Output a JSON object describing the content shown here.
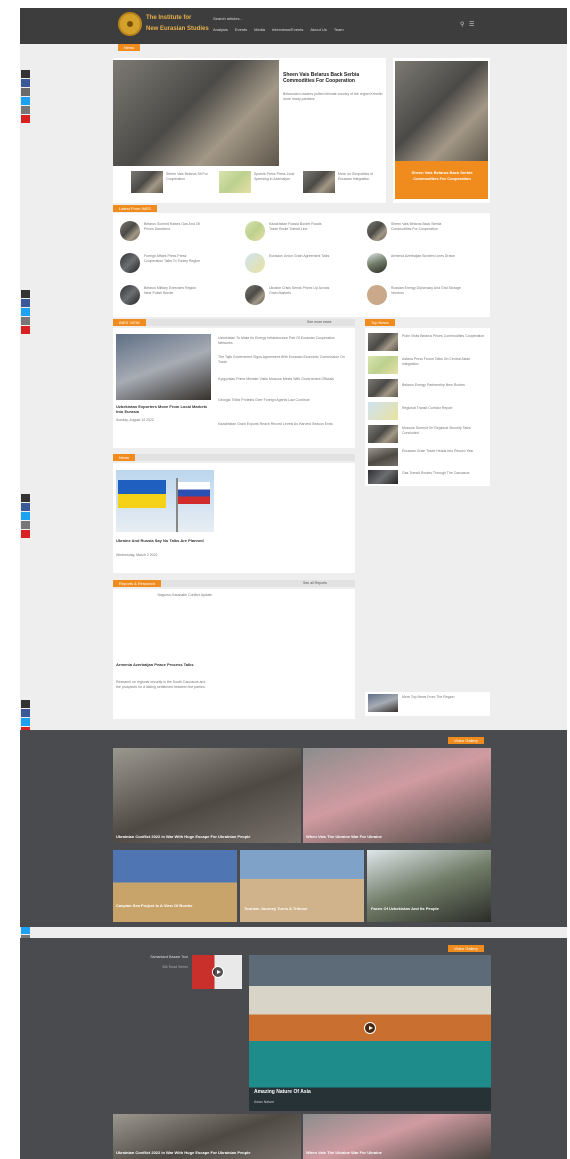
{
  "header": {
    "logo_line1": "The Institute for",
    "logo_line2": "New Eurasian Studies",
    "search_text": "Search articles...",
    "nav": [
      "Analysis",
      "Events",
      "Media",
      "Interviews/Events",
      "About Us",
      "Team"
    ]
  },
  "tabs": {
    "news": "News",
    "latest_news": "Latest From INES",
    "ines_view": "INES VIEW",
    "top_news": "Top News",
    "news2": "News",
    "ines_reports": "Reports & Research",
    "video_gallery": "Video Gallery",
    "video_gallery2": "Video Gallery"
  },
  "view_all": "See more news",
  "hero": {
    "title": "Sheen Vais Belarus Back Serbia Commodities For Cooperation",
    "excerpt": "Belarusian Leaders pulled intimate country of the region Kremlin more ready partners",
    "side_caption": "Sheen Vais Belarus Back Serbia Commodities For Cooperation"
  },
  "hero_strip": [
    "Sheen Vais Belarus Sit For Cooperation",
    "Sputnik Press Press Zone Spending in Azerbaijan",
    "More on Geopolitics of Eurasian Integration"
  ],
  "latest": [
    "Belarus Summit Raises Gas And Oil Prices Sanctions",
    "Kazakhstan Russia Border Roads Trade Route Transit Line",
    "Sheen Vais Belarus Back Serbia Commodities For Cooperation",
    "Foreign Affairs Press Press Cooperation Talks To Turkey Region",
    "Eurasian Union Grain Agreement Talks",
    "Armenia Azerbaijan Borders Lines Drawn",
    "Belarus Military Exercises Region Near Polish Border",
    "Ukraine Crisis Sends Prices Up Across Grain Markets",
    "Russian Energy Diplomacy And Grid Storage Vendors"
  ],
  "ines_view": {
    "lead_title": "Uzbekistan Exporters Move From Local Markets Into Eurasia",
    "lead_meta": "Sunday, August 14 2022",
    "bullets": [
      "Uzbekistan To Make Its Energy Infrastructure Part Of Eurasian Cooperation Networks",
      "The Tajik Government Signs Agreement With Eurasian Economic Commission On Trade",
      "Kyrgyzstan Prime Minister Visits Moscow Meets With Government Officials",
      "Georgia Tbilisi Protests Over Foreign Agents Law Continue",
      "Kazakhstan Grain Exports Reach Record Levels As Harvest Season Ends"
    ]
  },
  "top_news": [
    "Putin Visits Belarus Prices Commodities Cooperation",
    "Astana Press Forum Talks On Central Asian Integration",
    "Belarus Energy Partnership New Routes",
    "Regional Transit Corridor Report",
    "Moscow Summit On Regional Security Talks Concluded",
    "Eurasian Grain Trade Heads Into Record Year",
    "Gas Transit Routes Through The Caucasus"
  ],
  "news2": {
    "title": "Ukraine And Russia Say No Talks Are Planned",
    "meta": "Wednesday, March 2 2022"
  },
  "reports": {
    "view_all": "See all Reports",
    "feature_caption": "Nagorno-Karabakh Conflict Update",
    "title": "Armenia Azerbaijan Peace Process Talks",
    "excerpt": "Research on regional security in the South Caucasus and the prospects for a lasting settlement between the parties."
  },
  "bottom_top_news": "More Top News From The Region",
  "video1": [
    "Ukrainian Conflict 2022 in War With Huge Escape For Ukrainian People",
    "When Vais The Ukraine War For Ukraine",
    "Caspian Sea Project Is A View Of Border",
    "Tourism Journey Turns A Tribune",
    "Faces Of Uzbekistan And Its People"
  ],
  "video2": {
    "side_title": "Samarkand Bazaar Tour",
    "side_meta": "Silk Road Series",
    "main_title": "Amazing Nature Of Asia",
    "main_meta": "Asian Nature"
  },
  "video3": [
    "Ukrainian Conflict 2022 in War With Huge Escape For Ukrainian People",
    "When Vais The Ukraine War For Ukraine"
  ],
  "colors": {
    "accent": "#f08c1e",
    "header": "#3d3d3d",
    "dark_band": "#4a4b4e"
  }
}
